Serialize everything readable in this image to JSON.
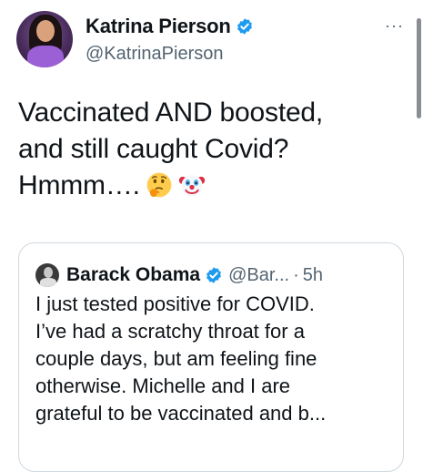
{
  "tweet": {
    "author": {
      "display_name": "Katrina Pierson",
      "handle": "@KatrinaPierson",
      "verified": true
    },
    "text": "Vaccinated AND boosted,\nand still caught Covid?\nHmmm….",
    "emojis": [
      "thinking-face",
      "clown-face"
    ],
    "more_label": "···"
  },
  "quoted_tweet": {
    "author": {
      "display_name": "Barack Obama",
      "handle": "@Bar...",
      "verified": true
    },
    "separator": "·",
    "time": "5h",
    "lines": [
      "I just tested positive for COVID.",
      "I’ve had a scratchy throat for a",
      "couple days, but am feeling fine",
      "otherwise. Michelle and I are",
      "grateful to be vaccinated and b..."
    ]
  },
  "colors": {
    "verified_blue": "#1d9bf0",
    "text": "#0f1419",
    "secondary": "#536471",
    "border": "#cfd9de"
  }
}
